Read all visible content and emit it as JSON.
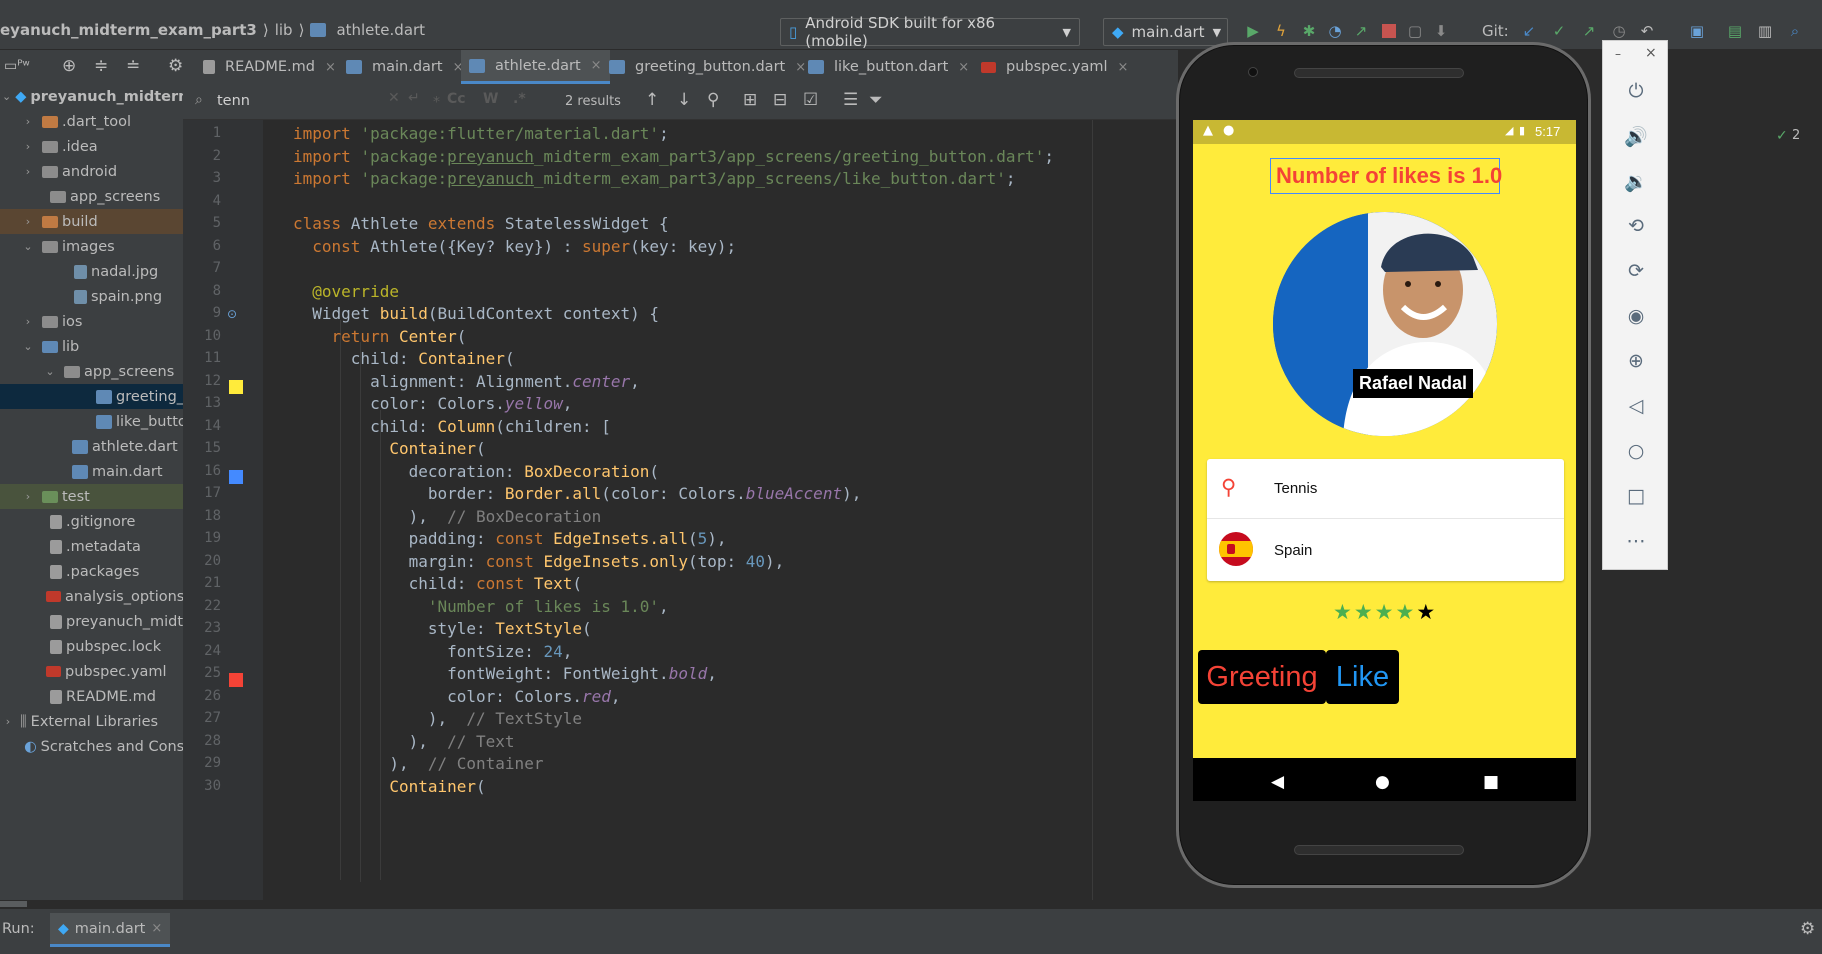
{
  "window": {
    "breadcrumb_project": "eyanuch_midterm_exam_part3",
    "breadcrumb_sep": "⟩",
    "breadcrumb_lib": "lib",
    "breadcrumb_file": "athlete.dart"
  },
  "toolbar": {
    "device_label": "Android SDK built for x86 (mobile)",
    "run_config_label": "main.dart",
    "git_label": "Git:"
  },
  "project_tree": {
    "title": "preyanuch_midterm",
    "items": [
      {
        "label": "preyanuch_midterm",
        "icon": "module-icon"
      },
      {
        "label": ".dart_tool",
        "icon": "folder-icon"
      },
      {
        "label": ".idea",
        "icon": "folder-icon"
      },
      {
        "label": "android",
        "icon": "folder-icon"
      },
      {
        "label": "app_screens",
        "icon": "folder-icon"
      },
      {
        "label": "build",
        "icon": "folder-icon"
      },
      {
        "label": "images",
        "icon": "folder-icon"
      },
      {
        "label": "nadal.jpg",
        "icon": "image-file-icon"
      },
      {
        "label": "spain.png",
        "icon": "image-file-icon"
      },
      {
        "label": "ios",
        "icon": "folder-icon"
      },
      {
        "label": "lib",
        "icon": "folder-icon"
      },
      {
        "label": "app_screens",
        "icon": "folder-icon"
      },
      {
        "label": "greeting_b",
        "icon": "dart-file-icon"
      },
      {
        "label": "like_buttor",
        "icon": "dart-file-icon"
      },
      {
        "label": "athlete.dart",
        "icon": "dart-file-icon"
      },
      {
        "label": "main.dart",
        "icon": "dart-file-icon"
      },
      {
        "label": "test",
        "icon": "folder-icon"
      },
      {
        "label": ".gitignore",
        "icon": "file-icon"
      },
      {
        "label": ".metadata",
        "icon": "file-icon"
      },
      {
        "label": ".packages",
        "icon": "file-icon"
      },
      {
        "label": "analysis_options.y",
        "icon": "yaml-file-icon"
      },
      {
        "label": "preyanuch_midte",
        "icon": "file-icon"
      },
      {
        "label": "pubspec.lock",
        "icon": "file-icon"
      },
      {
        "label": "pubspec.yaml",
        "icon": "yaml-file-icon"
      },
      {
        "label": "README.md",
        "icon": "file-icon"
      },
      {
        "label": "External Libraries",
        "icon": "library-icon"
      },
      {
        "label": "Scratches and Conso",
        "icon": "scratch-icon"
      }
    ]
  },
  "editor": {
    "tabs": [
      {
        "label": "README.md",
        "active": false
      },
      {
        "label": "main.dart",
        "active": false
      },
      {
        "label": "athlete.dart",
        "active": true
      },
      {
        "label": "greeting_button.dart",
        "active": false
      },
      {
        "label": "like_button.dart",
        "active": false
      },
      {
        "label": "pubspec.yaml",
        "active": false
      }
    ],
    "search_value": "tenn",
    "search_results": "2 results",
    "line_numbers": [
      "1",
      "2",
      "3",
      "4",
      "5",
      "6",
      "7",
      "8",
      "9",
      "10",
      "11",
      "12",
      "13",
      "14",
      "15",
      "16",
      "17",
      "18",
      "19",
      "20",
      "21",
      "22",
      "23",
      "24",
      "25",
      "26",
      "27",
      "28",
      "29",
      "30"
    ],
    "gutter_colors": {
      "line13": "#ffeb3b",
      "line17": "#448aff",
      "line26": "#f44336"
    },
    "inspection_count": "2"
  },
  "emulator": {
    "status_time": "5:17",
    "likes_text": "Number of likes is 1.0",
    "athlete_name": "Rafael Nadal",
    "sport_label": "Tennis",
    "country_label": "Spain",
    "stars_filled": 4,
    "stars_total": 5,
    "greeting_label": "Greeting",
    "like_label": "Like",
    "colors": {
      "background": "#ffeb3b",
      "likes_text": "#f44336",
      "border": "#448aff",
      "star_green": "#4caf50",
      "greeting": "#f44336",
      "like": "#2196f3"
    }
  },
  "emulator_controls": {
    "minimize": "–",
    "close": "×"
  },
  "run_bar": {
    "label": "Run:",
    "tab": "main.dart"
  }
}
